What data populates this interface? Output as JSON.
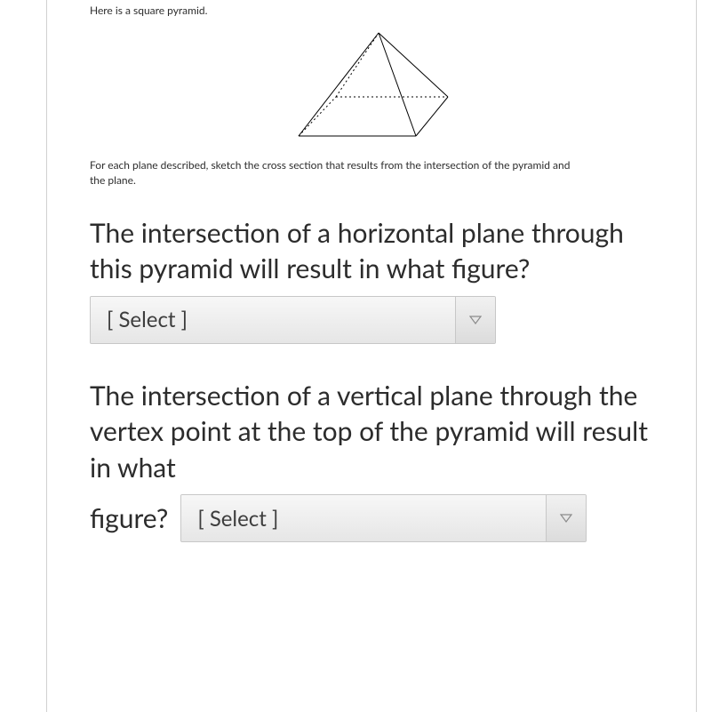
{
  "intro": "Here is a square pyramid.",
  "instructions": "For each plane described, sketch the cross section that results from the intersection of the pyramid and the plane.",
  "questions": {
    "q1": {
      "text": "The intersection of a horizontal plane through this pyramid will result in what figure?",
      "select_placeholder": "[ Select ]"
    },
    "q2": {
      "text": "The intersection of a vertical plane through the vertex point at the top of the pyramid will result in what",
      "trailing_label": "figure?",
      "select_placeholder": "[ Select ]"
    }
  }
}
